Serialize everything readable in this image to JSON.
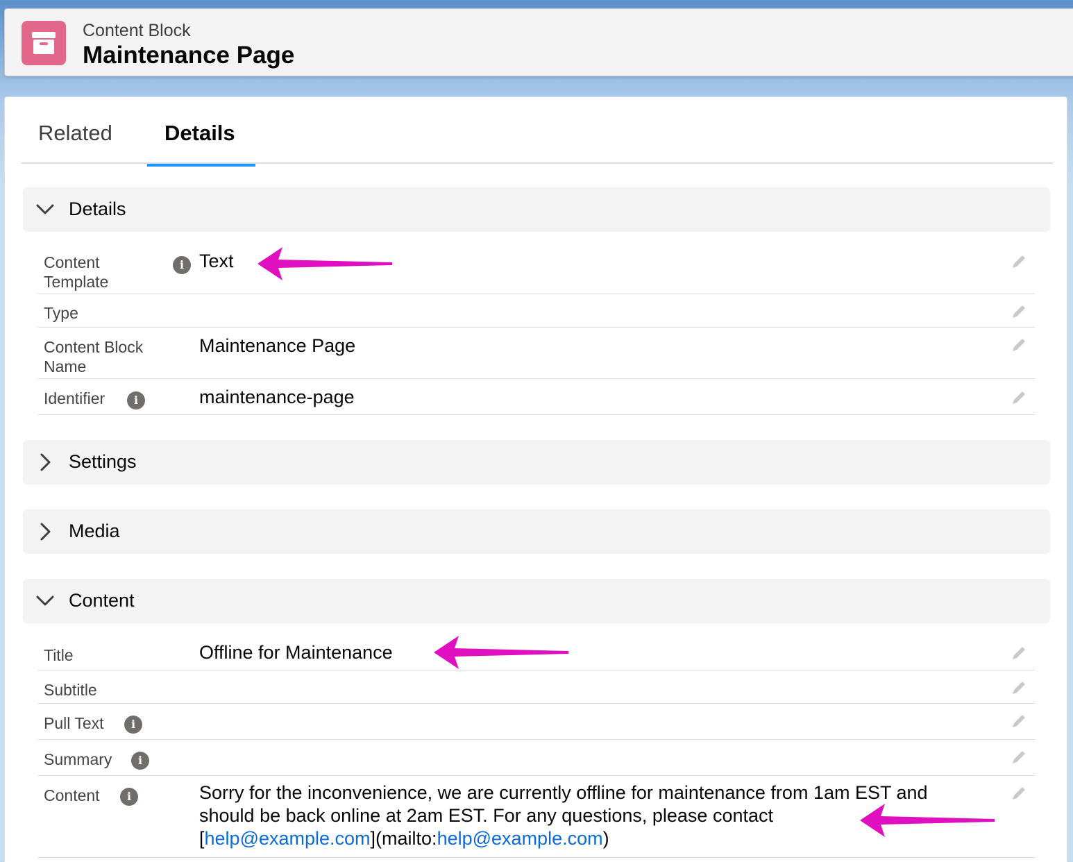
{
  "header": {
    "object_type": "Content Block",
    "record_title": "Maintenance Page"
  },
  "tabs": [
    {
      "label": "Related"
    },
    {
      "label": "Details"
    }
  ],
  "sections": {
    "details": {
      "label": "Details"
    },
    "settings": {
      "label": "Settings"
    },
    "media": {
      "label": "Media"
    },
    "content": {
      "label": "Content"
    }
  },
  "details_fields": {
    "content_template": {
      "label_line1": "Content",
      "label_line2": "Template",
      "value": "Text"
    },
    "type": {
      "label": "Type",
      "value": ""
    },
    "content_block_name": {
      "label_line1": "Content Block",
      "label_line2": "Name",
      "value": "Maintenance Page"
    },
    "identifier": {
      "label": "Identifier",
      "value": "maintenance-page"
    }
  },
  "content_fields": {
    "title": {
      "label": "Title",
      "value": "Offline for Maintenance"
    },
    "subtitle": {
      "label": "Subtitle",
      "value": ""
    },
    "pull_text": {
      "label": "Pull Text",
      "value": ""
    },
    "summary": {
      "label": "Summary",
      "value": ""
    },
    "content": {
      "label": "Content",
      "line1": "Sorry for the inconvenience, we are currently offline for maintenance from 1am EST and",
      "line2": "should be back online at 2am EST. For any questions, please contact",
      "bracket_open": "[",
      "link1": "help@example.com",
      "middle": "](mailto:",
      "link2": "help@example.com",
      "bracket_close": ")"
    }
  },
  "colors": {
    "accent": "#1b96ff",
    "annotation_arrow": "#e010c0",
    "object_icon": "#e3678a",
    "link": "#0b6bd6"
  },
  "icons": {
    "object": "archive-box-icon",
    "info": "info-icon",
    "edit": "pencil-icon",
    "collapse": "chevron-down-icon",
    "expand": "chevron-right-icon"
  }
}
